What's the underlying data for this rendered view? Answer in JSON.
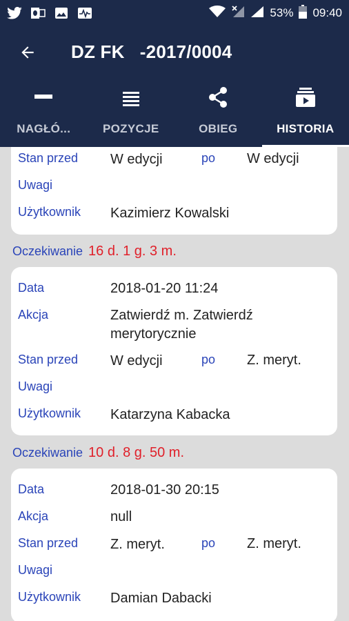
{
  "status_bar": {
    "icons": [
      "twitter-icon",
      "outlook-icon",
      "image-icon",
      "activity-icon"
    ],
    "battery": "53%",
    "time": "09:40"
  },
  "header": {
    "title": "DZ FK   -2017/0004"
  },
  "tabs": [
    {
      "label": "NAGŁÓ...",
      "icon": "header-icon",
      "active": false
    },
    {
      "label": "POZYCJE",
      "icon": "list-icon",
      "active": false
    },
    {
      "label": "OBIEG",
      "icon": "share-icon",
      "active": false
    },
    {
      "label": "HISTORIA",
      "icon": "history-icon",
      "active": true
    }
  ],
  "labels": {
    "data": "Data",
    "akcja": "Akcja",
    "stan_przed": "Stan przed",
    "po": "po",
    "uwagi": "Uwagi",
    "uzytkownik": "Użytkownik",
    "oczekiwanie": "Oczekiwanie"
  },
  "history": [
    {
      "stan_przed": "W edycji",
      "po": "W edycji",
      "uwagi": "",
      "uzytkownik": "Kazimierz Kowalski"
    },
    {
      "oczekiwanie": "16 d. 1 g. 3 m.",
      "data": "2018-01-20 11:24",
      "akcja": "Zatwierdź m. Zatwierdź merytorycznie",
      "stan_przed": "W edycji",
      "po": "Z. meryt.",
      "uwagi": "",
      "uzytkownik": "Katarzyna Kabacka"
    },
    {
      "oczekiwanie": "10 d. 8 g. 50 m.",
      "data": "2018-01-30 20:15",
      "akcja": "null",
      "stan_przed": "Z. meryt.",
      "po": "Z. meryt.",
      "uwagi": "",
      "uzytkownik": "Damian Dabacki"
    }
  ],
  "colors": {
    "primary": "#1c2a4a",
    "label": "#2a44b8",
    "wait_value": "#e0202a",
    "background": "#dcdcdc"
  }
}
